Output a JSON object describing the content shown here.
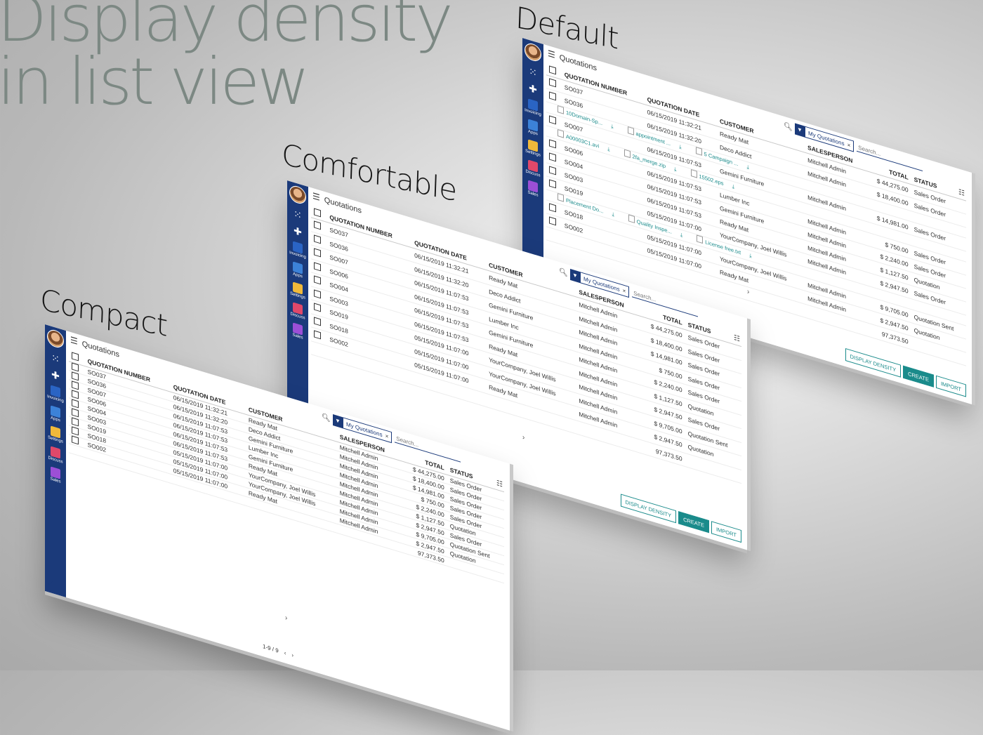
{
  "headline": "Display density\nin list view",
  "variants": {
    "default": "Default",
    "comfortable": "Comfortable",
    "compact": "Compact"
  },
  "sidebar": {
    "apps": [
      {
        "label": "Invoicing",
        "color": "#2a64c4"
      },
      {
        "label": "Apps",
        "color": "#3c82d8"
      },
      {
        "label": "Settings",
        "color": "#f0b93a"
      },
      {
        "label": "Discuss",
        "color": "#e0486a"
      },
      {
        "label": "Sales",
        "color": "#9c4fd6"
      }
    ]
  },
  "control_panel": {
    "breadcrumb": "Quotations",
    "facet": "My Quotations",
    "search_placeholder": "Search..."
  },
  "columns": [
    "QUOTATION NUMBER",
    "QUOTATION DATE",
    "CUSTOMER",
    "SALESPERSON",
    "TOTAL",
    "STATUS"
  ],
  "rows": [
    {
      "number": "SO037",
      "date": "06/15/2019 11:32:21",
      "customer": "Ready Mat",
      "salesperson": "Mitchell Admin",
      "total": "$ 44,275.00",
      "status": "Sales Order"
    },
    {
      "number": "SO036",
      "date": "06/15/2019 11:32:20",
      "customer": "Deco Addict",
      "salesperson": "Mitchell Admin",
      "total": "$ 18,400.00",
      "status": "Sales Order"
    },
    {
      "number": "SO007",
      "date": "06/15/2019 11:07:53",
      "customer": "Gemini Furniture",
      "salesperson": "Mitchell Admin",
      "total": "$ 14,981.00",
      "status": "Sales Order"
    },
    {
      "number": "SO006",
      "date": "06/15/2019 11:07:53",
      "customer": "Lumber Inc",
      "salesperson": "Mitchell Admin",
      "total": "$ 750.00",
      "status": "Sales Order"
    },
    {
      "number": "SO004",
      "date": "06/15/2019 11:07:53",
      "customer": "Gemini Furniture",
      "salesperson": "Mitchell Admin",
      "total": "$ 2,240.00",
      "status": "Sales Order"
    },
    {
      "number": "SO003",
      "date": "06/15/2019 11:07:53",
      "customer": "Ready Mat",
      "salesperson": "Mitchell Admin",
      "total": "$ 1,127.50",
      "status": "Quotation"
    },
    {
      "number": "SO019",
      "date": "05/15/2019 11:07:00",
      "customer": "YourCompany, Joel Willis",
      "salesperson": "Mitchell Admin",
      "total": "$ 2,947.50",
      "status": "Sales Order"
    },
    {
      "number": "SO018",
      "date": "05/15/2019 11:07:00",
      "customer": "YourCompany, Joel Willis",
      "salesperson": "Mitchell Admin",
      "total": "$ 9,705.00",
      "status": "Quotation Sent"
    },
    {
      "number": "SO002",
      "date": "05/15/2019 11:07:00",
      "customer": "Ready Mat",
      "salesperson": "Mitchell Admin",
      "total": "$ 2,947.50",
      "status": "Quotation"
    }
  ],
  "grand_total": "97,373.50",
  "attachments": {
    "SO036": [
      "10Domain-Sp...",
      "appointment ...",
      "5 Campaign ..."
    ],
    "SO007": [
      "A00003C1.avi",
      "2fa_merge.zip",
      "15502.eps"
    ],
    "SO019": [
      "Placement Do...",
      "Quality Inspe...",
      "License free.txt"
    ]
  },
  "buttons": {
    "display_density": "DISPLAY DENSITY",
    "create": "CREATE",
    "import": "IMPORT"
  },
  "pager": "1-9 / 9",
  "colors": {
    "sidebar": "#1b3a7a",
    "accent": "#1a8b8b"
  }
}
